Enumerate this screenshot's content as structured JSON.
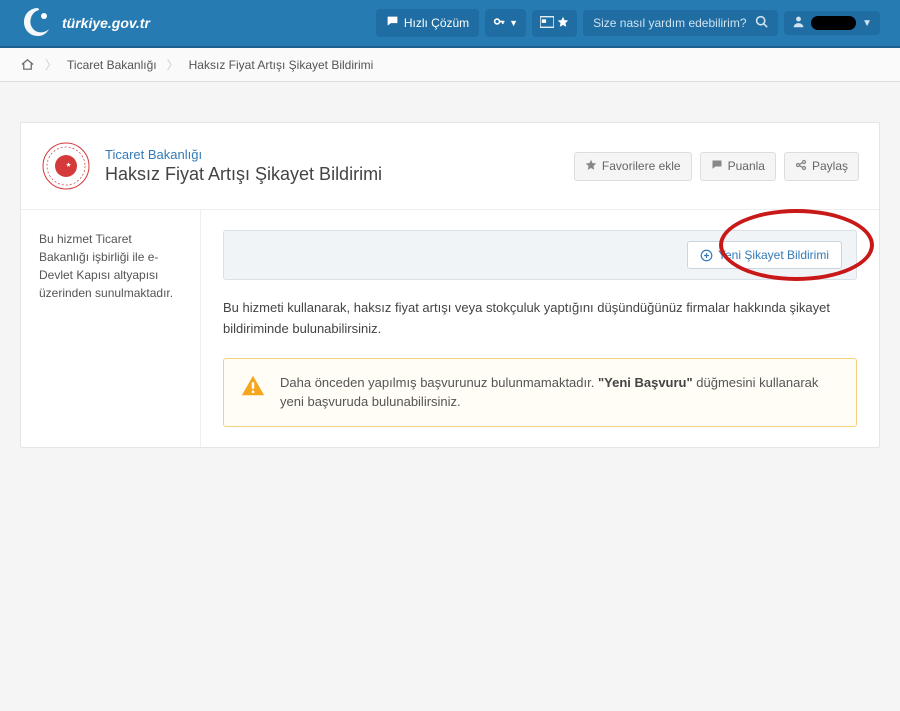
{
  "header": {
    "site_name": "türkiye.gov.tr",
    "quick_solution": "Hızlı Çözüm",
    "search_placeholder": "Size nasıl yardım edebilirim?"
  },
  "breadcrumb": {
    "ministry": "Ticaret Bakanlığı",
    "page": "Haksız Fiyat Artışı Şikayet Bildirimi"
  },
  "card": {
    "subtitle": "Ticaret Bakanlığı",
    "title": "Haksız Fiyat Artışı Şikayet Bildirimi",
    "actions": {
      "favorite": "Favorilere ekle",
      "rate": "Puanla",
      "share": "Paylaş"
    }
  },
  "sidebar": {
    "info": "Bu hizmet Ticaret Bakanlığı işbirliği ile e-Devlet Kapısı altyapısı üzerinden sunulmaktadır."
  },
  "main": {
    "new_complaint_button": "Yeni Şikayet Bildirimi",
    "description": "Bu hizmeti kullanarak, haksız fiyat artışı veya stokçuluk yaptığını düşündüğünüz firmalar hakkında şikayet bildiriminde bulunabilirsiniz.",
    "alert": {
      "text_before": "Daha önceden yapılmış başvurunuz bulunmamaktadır. ",
      "text_bold": "\"Yeni Başvuru\"",
      "text_after": " düğmesini kullanarak yeni başvuruda bulunabilirsiniz."
    }
  }
}
